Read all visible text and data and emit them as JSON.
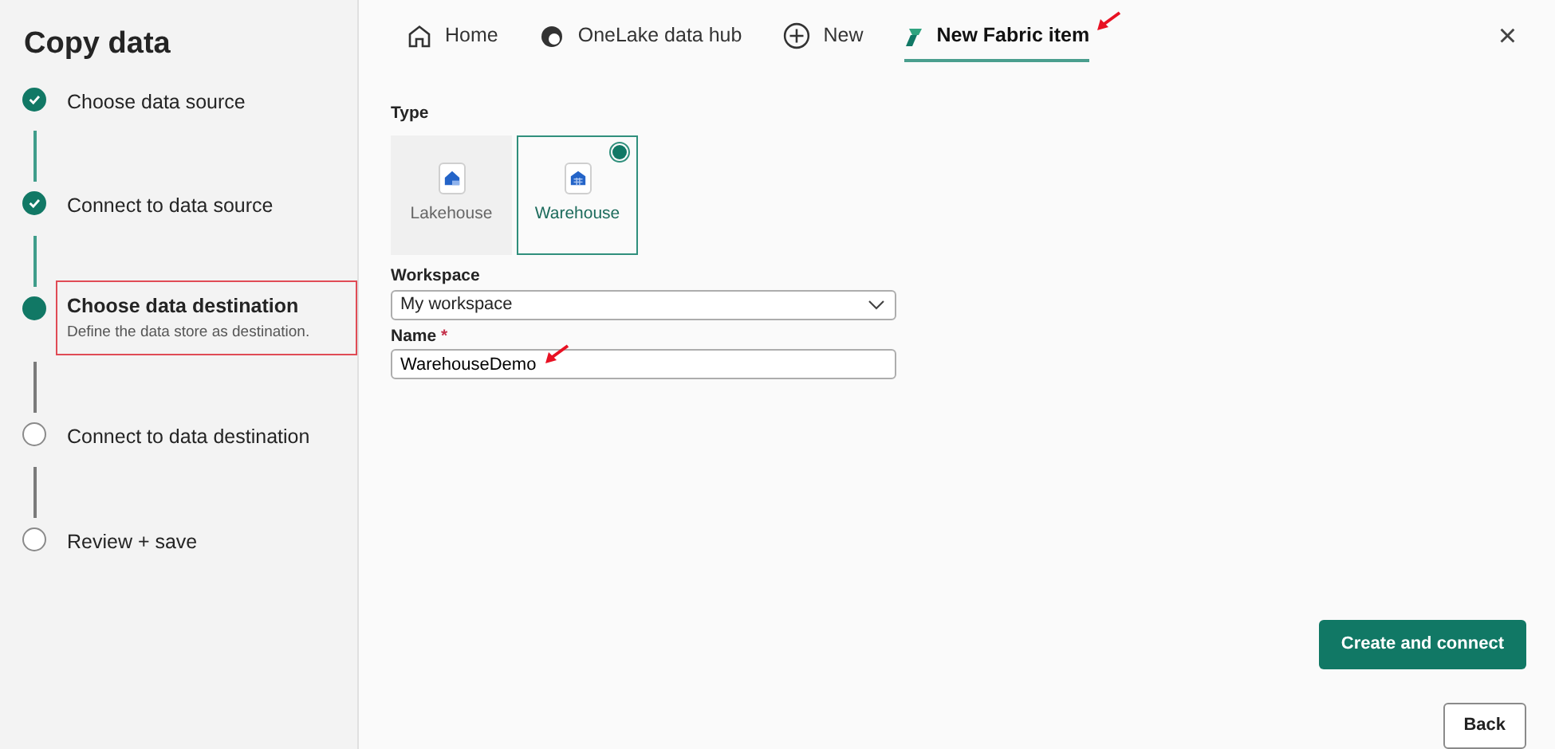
{
  "sidebar": {
    "title": "Copy data",
    "steps": [
      {
        "label": "Choose data source",
        "completed": true,
        "current": false,
        "highlighted": false
      },
      {
        "label": "Connect to data source",
        "completed": true,
        "current": false,
        "highlighted": false
      },
      {
        "label": "Choose data destination",
        "description": "Define the data store as destination.",
        "completed": false,
        "current": true,
        "highlighted": true
      },
      {
        "label": "Connect to data destination",
        "completed": false,
        "current": false,
        "highlighted": false
      },
      {
        "label": "Review + save",
        "completed": false,
        "current": false,
        "highlighted": false
      }
    ]
  },
  "tabs": [
    {
      "label": "Home",
      "selected": false,
      "annotated": false
    },
    {
      "label": "OneLake data hub",
      "selected": false,
      "annotated": false
    },
    {
      "label": "New",
      "selected": false,
      "annotated": false
    },
    {
      "label": "New Fabric item",
      "selected": true,
      "annotated": true
    }
  ],
  "close": "×",
  "type": {
    "label": "Type",
    "options": [
      {
        "label": "Lakehouse",
        "selected": false
      },
      {
        "label": "Warehouse",
        "selected": true
      }
    ]
  },
  "workspace": {
    "label": "Workspace",
    "value": "My workspace"
  },
  "name": {
    "label": "Name",
    "required": "*",
    "value": "WarehouseDemo",
    "annotated": true
  },
  "buttons": [
    {
      "label": "Create and connect",
      "kind": "primary"
    },
    {
      "label": "Back",
      "kind": "secondary"
    }
  ]
}
